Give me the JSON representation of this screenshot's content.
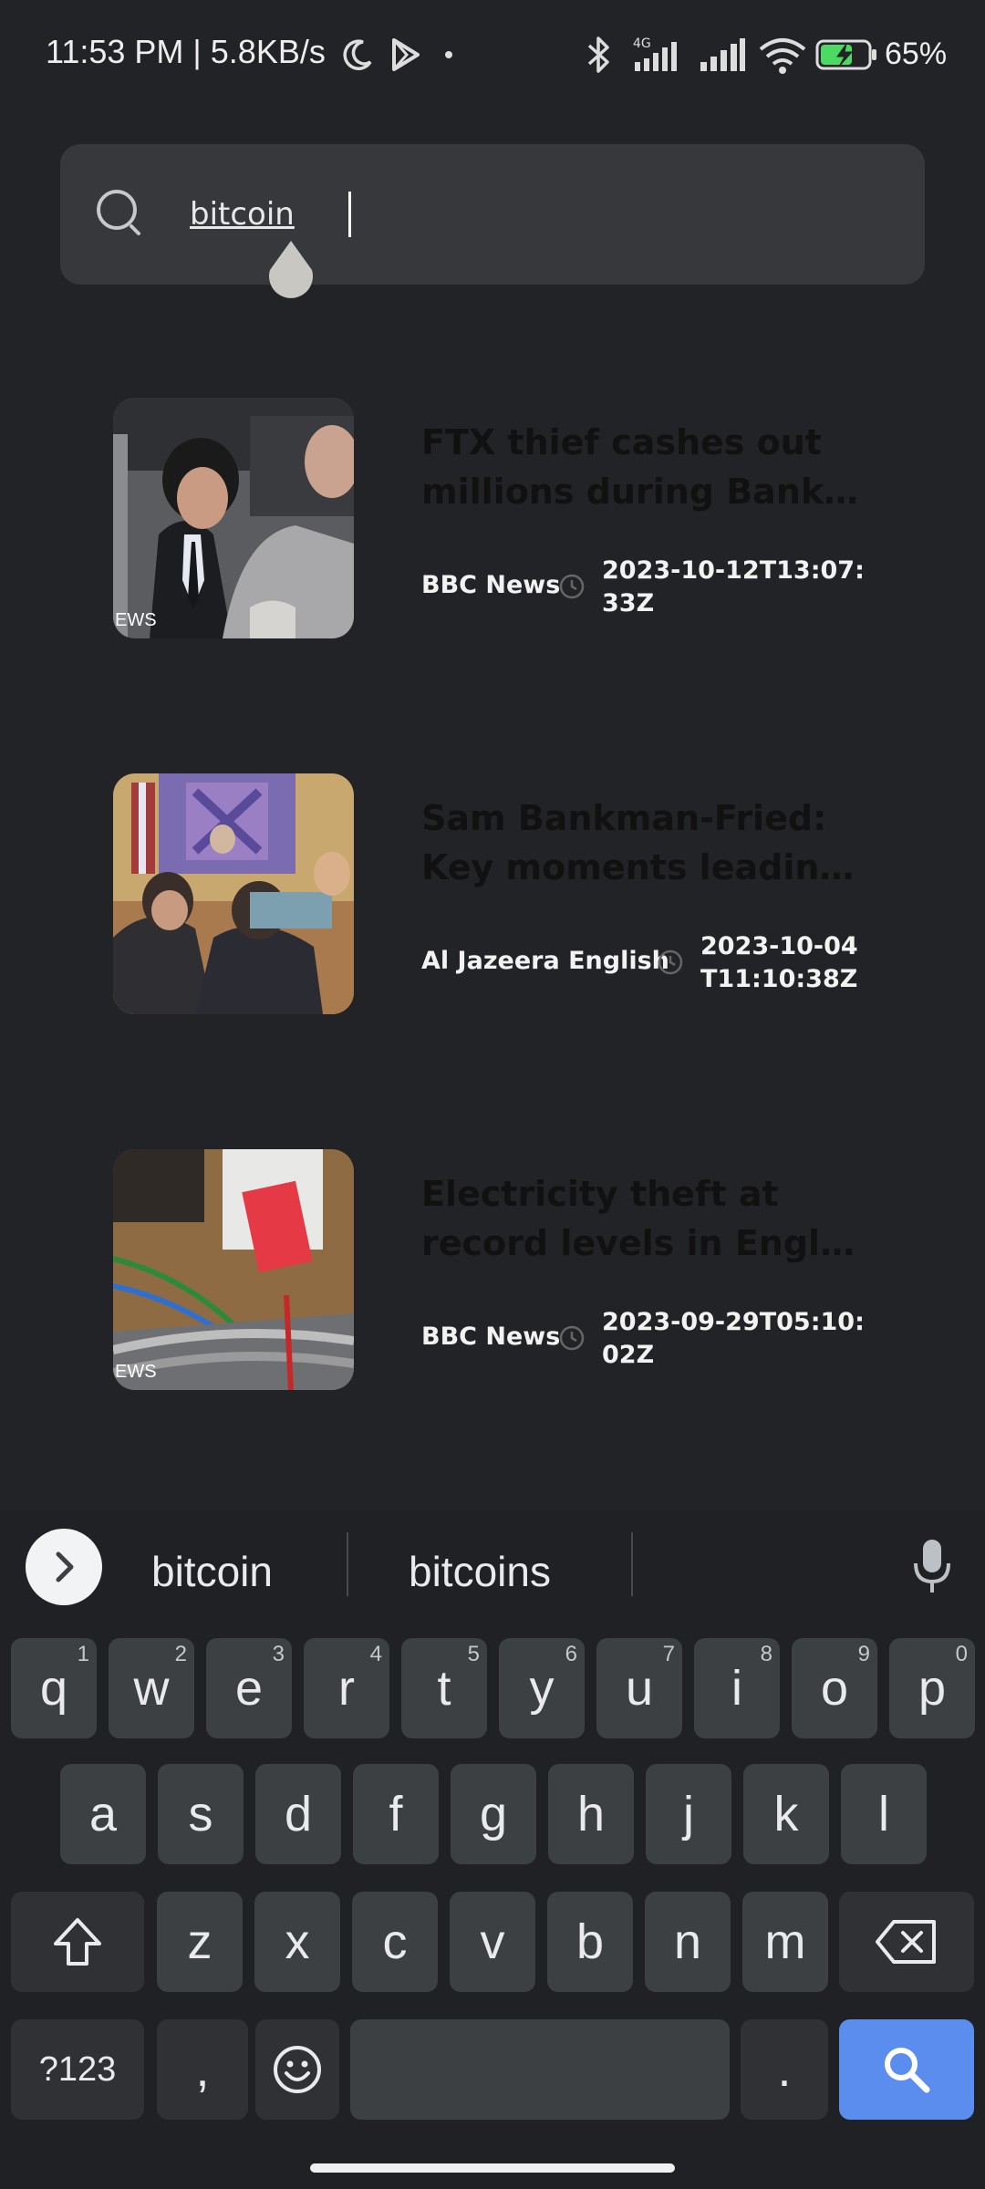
{
  "status_bar": {
    "time": "11:53 PM | 5.8KB/s",
    "battery": "65%"
  },
  "search": {
    "query": "bitcoin"
  },
  "articles": [
    {
      "title_line1": "FTX thief cashes out",
      "title_line2": "millions during Bankm...",
      "source": "BBC News",
      "published": "2023-10-12T13:07:33Z",
      "thumb_watermark": "EWS"
    },
    {
      "title_line1": "Sam Bankman-Fried:",
      "title_line2": "Key moments leading ...",
      "source": "Al Jazeera English",
      "published": "2023-10-04T11:10:38Z"
    },
    {
      "title_line1": "Electricity theft at",
      "title_line2": "record levels in Engla...",
      "source": "BBC News",
      "published": "2023-09-29T05:10:02Z",
      "thumb_watermark": "EWS"
    }
  ],
  "keyboard": {
    "suggestions": [
      "bitcoin",
      "bitcoins"
    ],
    "row1": [
      {
        "k": "q",
        "h": "1"
      },
      {
        "k": "w",
        "h": "2"
      },
      {
        "k": "e",
        "h": "3"
      },
      {
        "k": "r",
        "h": "4"
      },
      {
        "k": "t",
        "h": "5"
      },
      {
        "k": "y",
        "h": "6"
      },
      {
        "k": "u",
        "h": "7"
      },
      {
        "k": "i",
        "h": "8"
      },
      {
        "k": "o",
        "h": "9"
      },
      {
        "k": "p",
        "h": "0"
      }
    ],
    "row2": [
      "a",
      "s",
      "d",
      "f",
      "g",
      "h",
      "j",
      "k",
      "l"
    ],
    "row3": [
      "z",
      "x",
      "c",
      "v",
      "b",
      "n",
      "m"
    ],
    "symbols_label": "?123",
    "comma": ",",
    "period": "."
  }
}
